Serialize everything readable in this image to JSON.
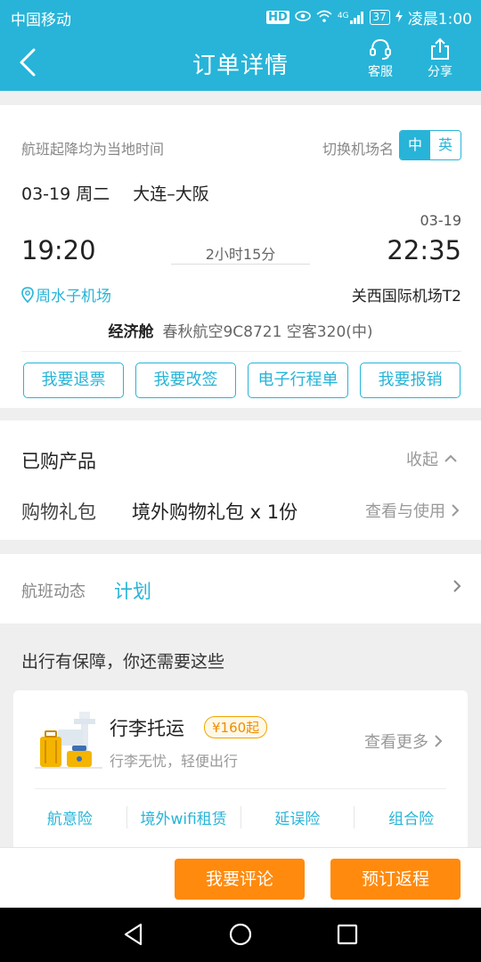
{
  "status_bar": {
    "carrier": "中国移动",
    "hd": "HD",
    "network": "4G",
    "battery": "37",
    "time": "凌晨1:00"
  },
  "nav": {
    "title": "订单详情",
    "service_label": "客服",
    "share_label": "分享"
  },
  "flight": {
    "hint": "航班起降均为当地时间",
    "switch_label": "切换机场名",
    "lang_cn": "中",
    "lang_en": "英",
    "date": "03-19 周二",
    "route": "大连–大阪",
    "arrival_date": "03-19",
    "dep_time": "19:20",
    "arr_time": "22:35",
    "duration": "2小时15分",
    "dep_airport": "周水子机场",
    "arr_airport": "关西国际机场T2",
    "cabin": "经济舱",
    "flight_info": "春秋航空9C8721 空客320(中)",
    "actions": [
      "我要退票",
      "我要改签",
      "电子行程单",
      "我要报销"
    ]
  },
  "purchased": {
    "title": "已购产品",
    "collapse": "收起",
    "item_label": "购物礼包",
    "item_name": "境外购物礼包 x 1份",
    "item_action": "查看与使用"
  },
  "flight_status": {
    "label": "航班动态",
    "value": "计划"
  },
  "guarantee": {
    "title": "出行有保障，你还需要这些",
    "service_title": "行李托运",
    "price": "¥160起",
    "subtitle": "行李无忧，轻便出行",
    "more": "查看更多",
    "insurances": [
      "航意险",
      "境外wifi租赁",
      "延误险",
      "组合险"
    ]
  },
  "bottom": {
    "comment": "我要评论",
    "return": "预订返程"
  },
  "colors": {
    "primary": "#27b4d8",
    "orange": "#ff8a0d"
  }
}
